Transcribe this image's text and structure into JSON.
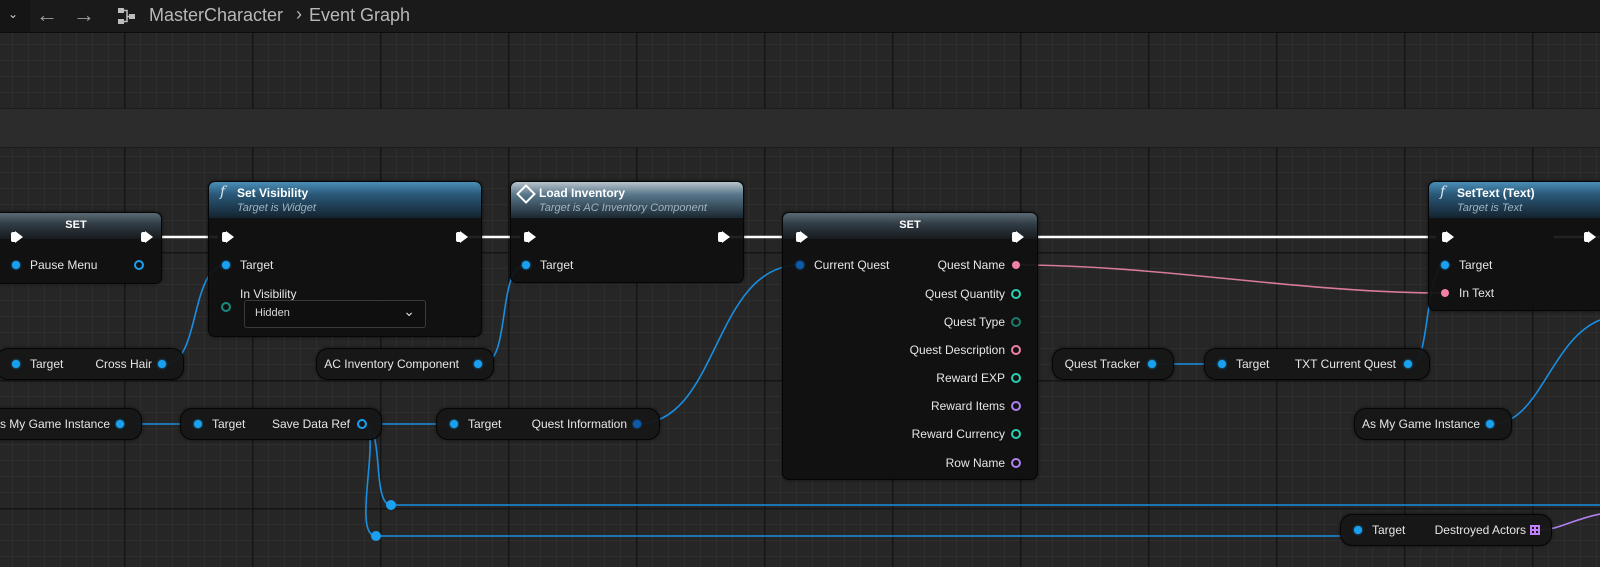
{
  "toolbar": {
    "nav_back": "←",
    "nav_forward": "→",
    "breadcrumb": [
      "MasterCharacter",
      "Event Graph"
    ],
    "breadcrumb_sep": "›"
  },
  "nodes": {
    "set_left": {
      "title": "SET",
      "pin_pause_menu": "Pause Menu"
    },
    "set_visibility": {
      "title": "Set Visibility",
      "subtitle": "Target is Widget",
      "pin_target": "Target",
      "pin_in_visibility": "In Visibility",
      "visibility_value": "Hidden"
    },
    "load_inventory": {
      "title": "Load Inventory",
      "subtitle": "Target is AC Inventory Component",
      "pin_target": "Target"
    },
    "set_quest": {
      "title": "SET",
      "pin_current_quest": "Current Quest",
      "outputs": [
        "Quest Name",
        "Quest Quantity",
        "Quest Type",
        "Quest Description",
        "Reward EXP",
        "Reward Items",
        "Reward Currency",
        "Row Name"
      ]
    },
    "settext": {
      "title": "SetText (Text)",
      "subtitle": "Target is Text",
      "pin_target": "Target",
      "pin_in_text": "In Text"
    },
    "crosshair_getter": {
      "in": "Target",
      "out": "Cross Hair"
    },
    "ac_inventory_comp": {
      "out": "AC Inventory Component"
    },
    "game_instance_left": {
      "out": "As My Game Instance"
    },
    "save_data_ref": {
      "in": "Target",
      "out": "Save Data Ref"
    },
    "quest_information": {
      "in": "Target",
      "out": "Quest Information"
    },
    "quest_tracker": {
      "out": "Quest Tracker"
    },
    "txt_current_quest": {
      "in": "Target",
      "out": "TXT Current Quest"
    },
    "game_instance_right": {
      "out": "As My Game Instance"
    },
    "destroyed_actors": {
      "in": "Target",
      "out": "Destroyed Actors"
    }
  }
}
